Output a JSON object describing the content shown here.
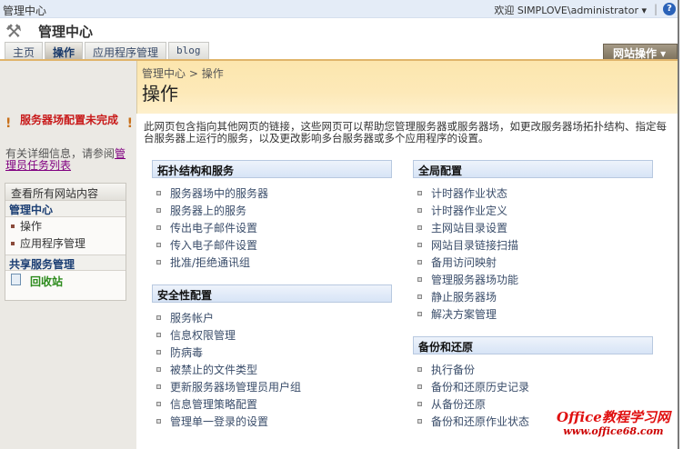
{
  "topbar": {
    "title": "管理中心",
    "welcome": "欢迎 SIMPLOVE\\administrator ▾",
    "separator": "|",
    "help": "?"
  },
  "header": {
    "title": "管理中心"
  },
  "tabs": [
    "主页",
    "操作",
    "应用程序管理",
    "blog"
  ],
  "site_actions": "网站操作 ▾",
  "breadcrumb": {
    "root": "管理中心",
    "sep": " > ",
    "current": "操作"
  },
  "page_title": "操作",
  "description": "此网页包含指向其他网页的链接，这些网页可以帮助您管理服务器或服务器场，如更改服务器场拓扑结构、指定每台服务器上运行的服务，以及更改影响多台服务器或多个应用程序的设置。",
  "sidebar": {
    "warning": "服务器场配置未完成",
    "info_text": "有关详细信息，请参阅",
    "info_link": "管理员任务列表",
    "view_all": "查看所有网站内容",
    "admin_header": "管理中心",
    "admin_items": [
      "操作",
      "应用程序管理"
    ],
    "shared_header": "共享服务管理",
    "recycle": "回收站"
  },
  "sections": {
    "topology": {
      "title": "拓扑结构和服务",
      "items": [
        "服务器场中的服务器",
        "服务器上的服务",
        "传出电子邮件设置",
        "传入电子邮件设置",
        "批准/拒绝通讯组"
      ]
    },
    "security": {
      "title": "安全性配置",
      "items": [
        "服务帐户",
        "信息权限管理",
        "防病毒",
        "被禁止的文件类型",
        "更新服务器场管理员用户组",
        "信息管理策略配置",
        "管理单一登录的设置"
      ]
    },
    "global": {
      "title": "全局配置",
      "items": [
        "计时器作业状态",
        "计时器作业定义",
        "主网站目录设置",
        "网站目录链接扫描",
        "备用访问映射",
        "管理服务器场功能",
        "静止服务器场",
        "解决方案管理"
      ]
    },
    "backup": {
      "title": "备份和还原",
      "items": [
        "执行备份",
        "备份和还原历史记录",
        "从备份还原",
        "备份和还原作业状态"
      ]
    }
  },
  "watermark": {
    "line1": "Office教程学习网",
    "line2": "www.office68.com"
  }
}
